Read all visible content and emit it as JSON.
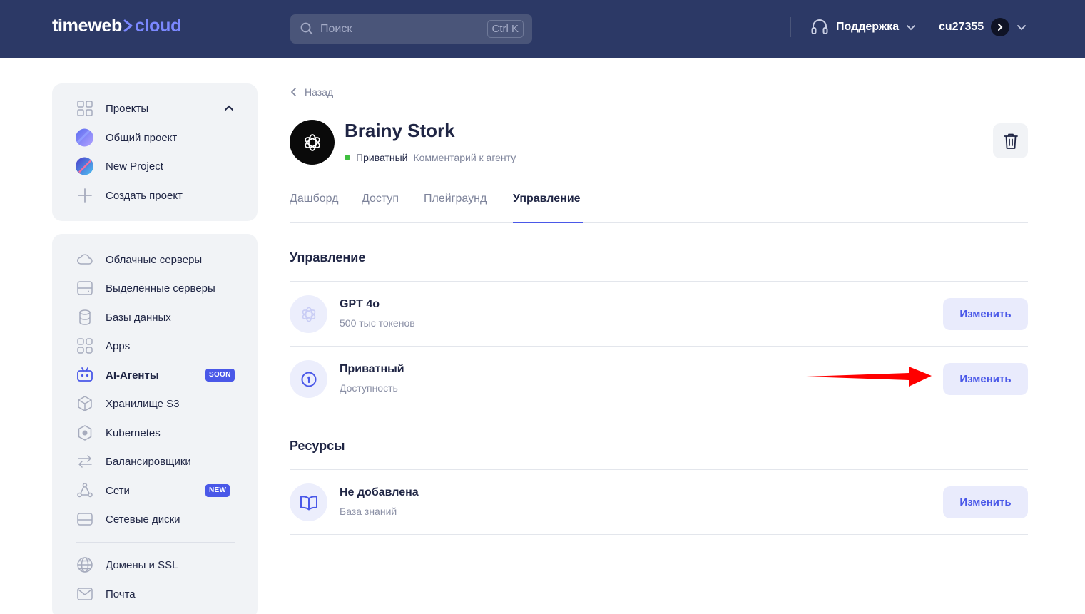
{
  "header": {
    "logo_part1": "timeweb",
    "logo_part2": "cloud",
    "search_placeholder": "Поиск",
    "search_shortcut": "Ctrl K",
    "support_label": "Поддержка",
    "user_label": "cu27355"
  },
  "projects": {
    "title": "Проекты",
    "items": [
      {
        "label": "Общий проект"
      },
      {
        "label": "New Project"
      },
      {
        "label": "Создать проект"
      }
    ]
  },
  "nav": {
    "items": [
      {
        "label": "Облачные серверы"
      },
      {
        "label": "Выделенные серверы"
      },
      {
        "label": "Базы данных"
      },
      {
        "label": "Apps"
      },
      {
        "label": "AI-Агенты",
        "badge": "SOON"
      },
      {
        "label": "Хранилище S3"
      },
      {
        "label": "Kubernetes"
      },
      {
        "label": "Балансировщики"
      },
      {
        "label": "Сети",
        "badge": "NEW"
      },
      {
        "label": "Сетевые диски"
      },
      {
        "label": "Домены и SSL"
      },
      {
        "label": "Почта"
      }
    ]
  },
  "page": {
    "back_label": "Назад",
    "agent_name": "Brainy Stork",
    "status": "Приватный",
    "comment": "Комментарий к агенту",
    "tabs": [
      {
        "label": "Дашборд"
      },
      {
        "label": "Доступ"
      },
      {
        "label": "Плейграунд"
      },
      {
        "label": "Управление",
        "active": true
      }
    ],
    "management": {
      "title": "Управление",
      "rows": [
        {
          "title": "GPT 4o",
          "subtitle": "500 тыс токенов",
          "button": "Изменить",
          "icon": "openai-icon"
        },
        {
          "title": "Приватный",
          "subtitle": "Доступность",
          "button": "Изменить",
          "icon": "lock-icon"
        }
      ]
    },
    "resources": {
      "title": "Ресурсы",
      "rows": [
        {
          "title": "Не добавлена",
          "subtitle": "База знаний",
          "button": "Изменить",
          "icon": "book-icon"
        }
      ]
    }
  },
  "colors": {
    "header_bg": "#2c3966",
    "accent": "#4a58e8",
    "logo_accent": "#7b88ff",
    "status_green": "#3fbf3f",
    "annotation_arrow": "#ff0000"
  }
}
